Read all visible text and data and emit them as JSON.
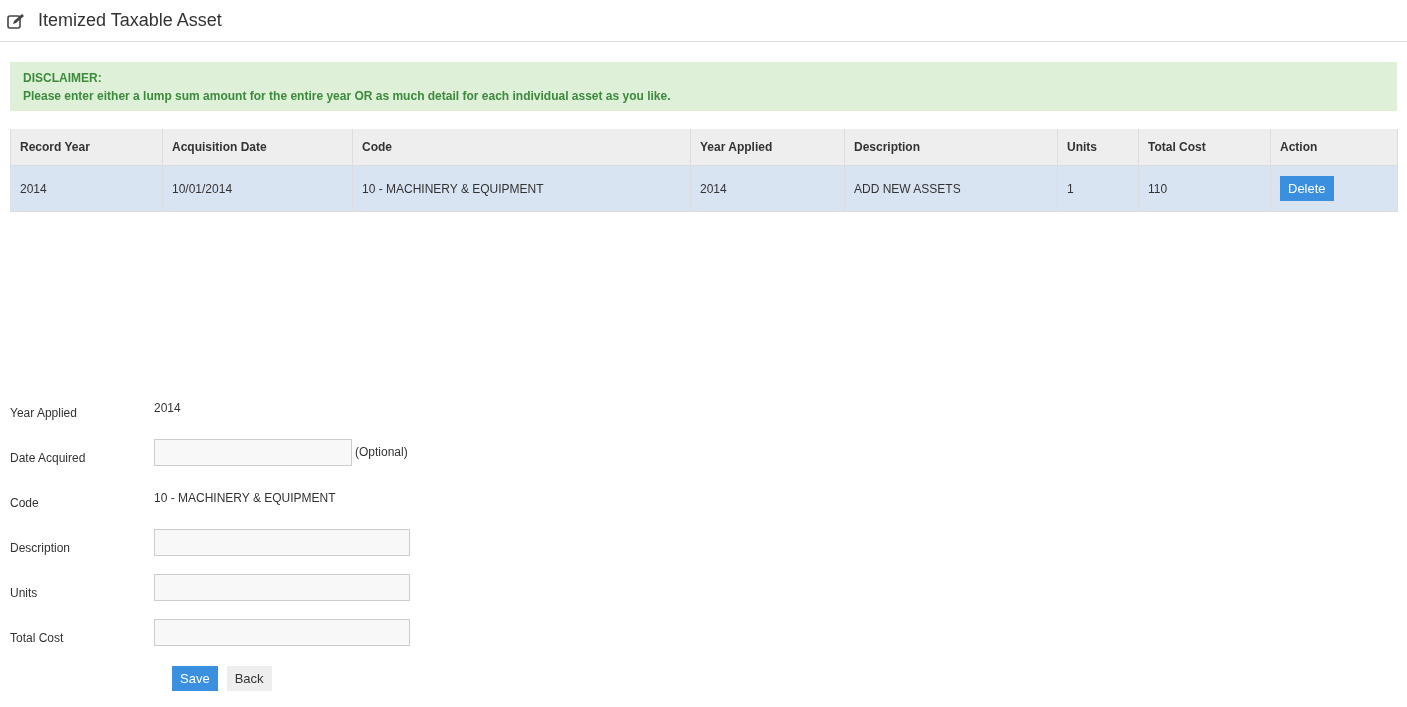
{
  "page": {
    "title": "Itemized Taxable Asset"
  },
  "disclaimer": {
    "heading": "DISCLAIMER:",
    "text": "Please enter either a lump sum amount for the entire year OR as much detail for each individual asset as you like."
  },
  "table": {
    "columns": [
      "Record Year",
      "Acquisition Date",
      "Code",
      "Year Applied",
      "Description",
      "Units",
      "Total Cost",
      "Action"
    ],
    "rows": [
      {
        "selected": true,
        "cells": [
          "2014",
          "10/01/2014",
          "10 - MACHINERY & EQUIPMENT",
          "2014",
          "ADD NEW ASSETS",
          "1",
          "110"
        ],
        "action": "Delete"
      }
    ]
  },
  "form": {
    "fields": [
      {
        "kind": "text",
        "label": "Year Applied",
        "value": "2014"
      },
      {
        "kind": "input",
        "label": "Date Acquired",
        "note": "(Optional)"
      },
      {
        "kind": "text",
        "label": "Code",
        "value": "10 - MACHINERY & EQUIPMENT"
      },
      {
        "kind": "input",
        "label": "Description"
      },
      {
        "kind": "input",
        "label": "Units"
      },
      {
        "kind": "input",
        "label": "Total Cost"
      }
    ],
    "buttons": [
      {
        "kind": "primary",
        "label": "Save"
      },
      {
        "kind": "default",
        "label": "Back"
      }
    ]
  }
}
